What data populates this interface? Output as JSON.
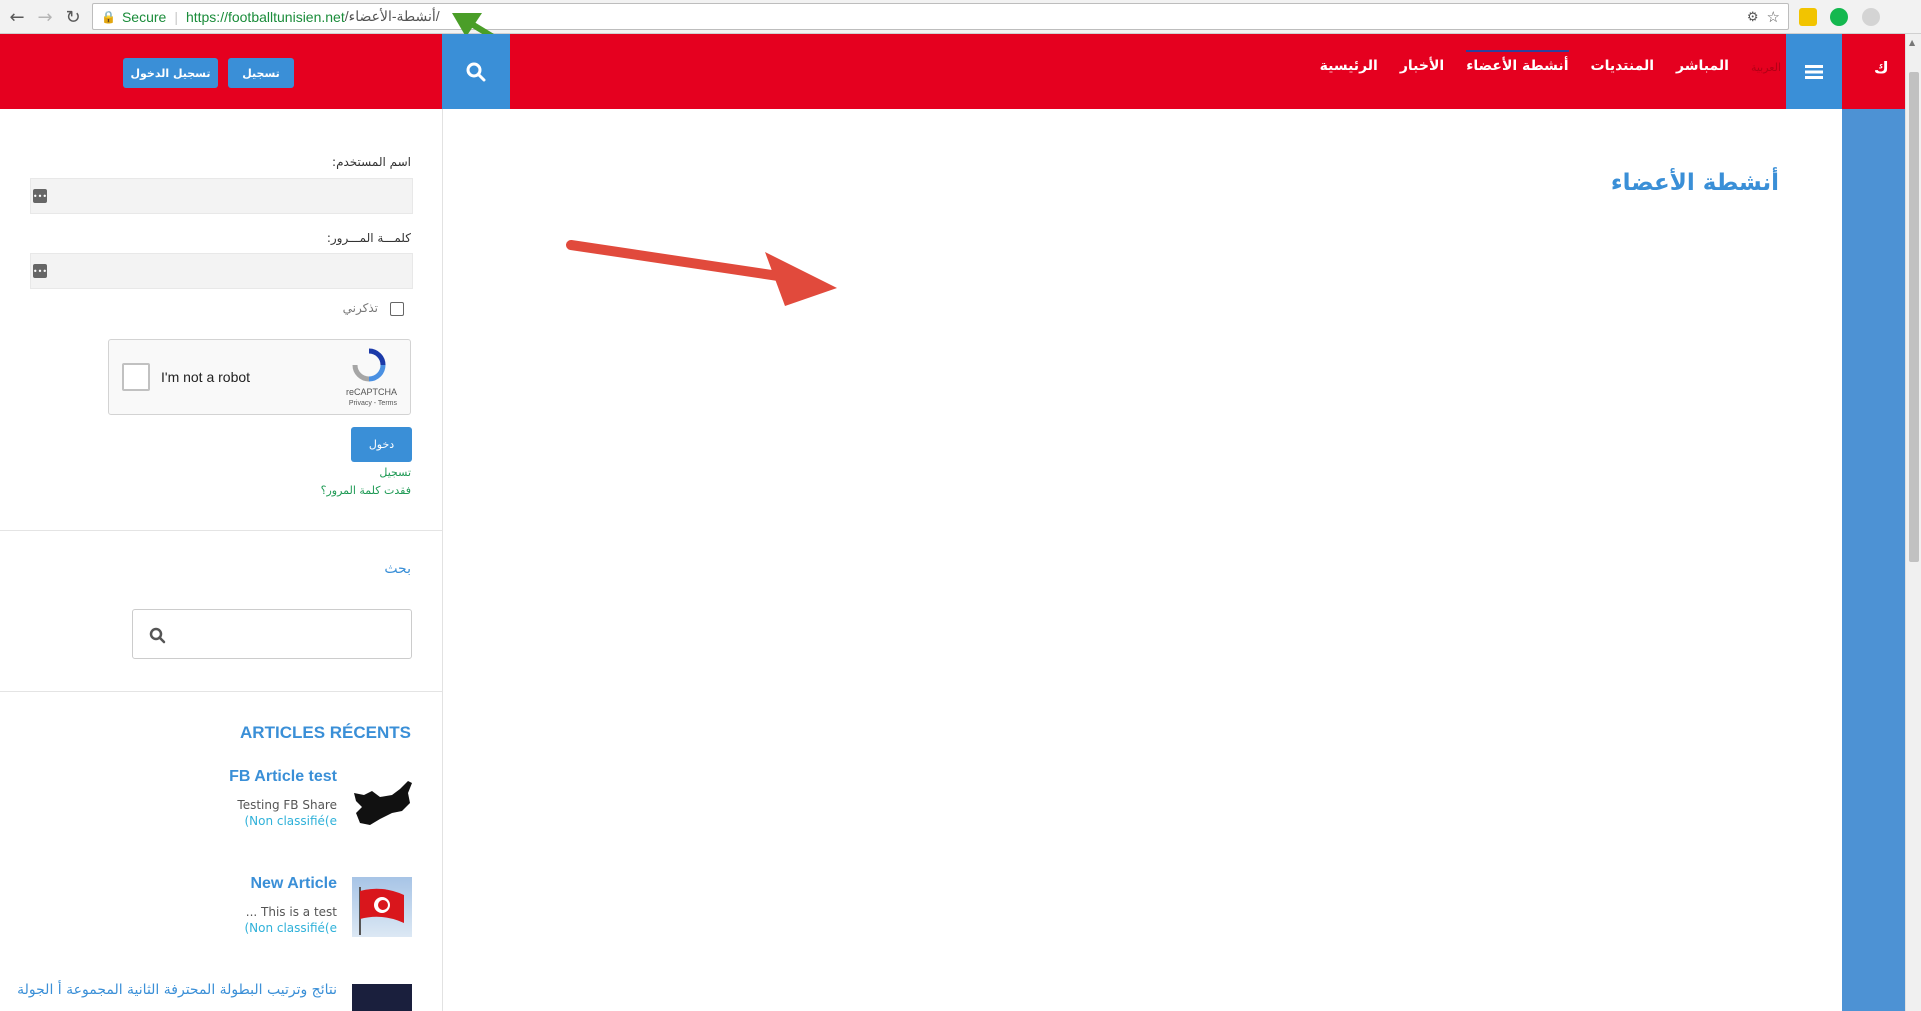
{
  "browser": {
    "secure_label": "Secure",
    "url_domain": "https://footballtunisien.net",
    "url_path": "/أنشطة-الأعضاء/"
  },
  "header": {
    "logo": "ك",
    "login_button": "تسجيل الدخول",
    "register_button": "تسجيل",
    "nav": [
      {
        "label": "الرئيسية"
      },
      {
        "label": "الأخبار"
      },
      {
        "label": "أنشطة الأعضاء"
      },
      {
        "label": "المنتديات"
      },
      {
        "label": "المباشر"
      },
      {
        "label": "العربية"
      }
    ],
    "accent": "#e5001f",
    "blue": "#3a8fd7"
  },
  "login": {
    "username_label": "اسم المستخدم:",
    "password_label": "كلمـــة المـــرور:",
    "remember_label": "تذكرني",
    "captcha_text": "I'm not a robot",
    "captcha_brand": "reCAPTCHA",
    "captcha_terms": "Privacy - Terms",
    "submit_label": "دخول",
    "register_link": "تسجيل",
    "lost_password_link": "فقدت كلمة المرور؟"
  },
  "search": {
    "title": "بحث"
  },
  "recent": {
    "title": "ARTICLES RÉCENTS",
    "articles": [
      {
        "title": "FB Article test",
        "desc": "Testing FB Share",
        "cat": "(Non classifié(e"
      },
      {
        "title": "New Article",
        "desc": "... This is a test",
        "cat": "(Non classifié(e"
      },
      {
        "title": "نتائج وترتيب البطولة المحترفة الثانية المجموعة أ الجولة"
      }
    ]
  },
  "main": {
    "page_title": "أنشطة الأعضاء"
  }
}
